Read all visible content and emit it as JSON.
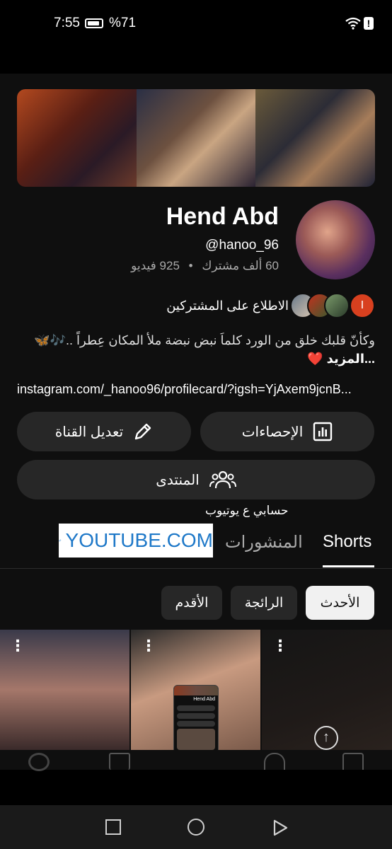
{
  "status_bar": {
    "time": "7:55",
    "battery": "%71"
  },
  "channel": {
    "name": "Hend Abd",
    "handle": "@hanoo_96",
    "subscribers": "60 ألف مشترك",
    "separator": "•",
    "videos": "925 فيديو",
    "subscribers_link": "الاطلاع على المشتركين",
    "subscriber_avatar_initial": "I",
    "description": "وكأنّ قلبك خلق من الورد كلماَ نبض نبضة ملأ المكان عِطراً ..🎶🦋",
    "more": "...المزيد",
    "heart": "❤️",
    "link": "instagram.com/_hanoo96/profilecard/?igsh=YjAxem9jcnB..."
  },
  "buttons": {
    "stats": "الإحصاءات",
    "edit": "تعديل القناة",
    "forum": "المنتدى"
  },
  "overlay": {
    "caption": "حسابي ع يوتيوب",
    "badge": "YOUTUBE.COM"
  },
  "tabs": {
    "shorts": "Shorts",
    "posts": "المنشورات"
  },
  "chips": {
    "newest": "الأحدث",
    "popular": "الرائجة",
    "oldest": "الأقدم"
  },
  "pip": {
    "name": "Hend Abd"
  }
}
